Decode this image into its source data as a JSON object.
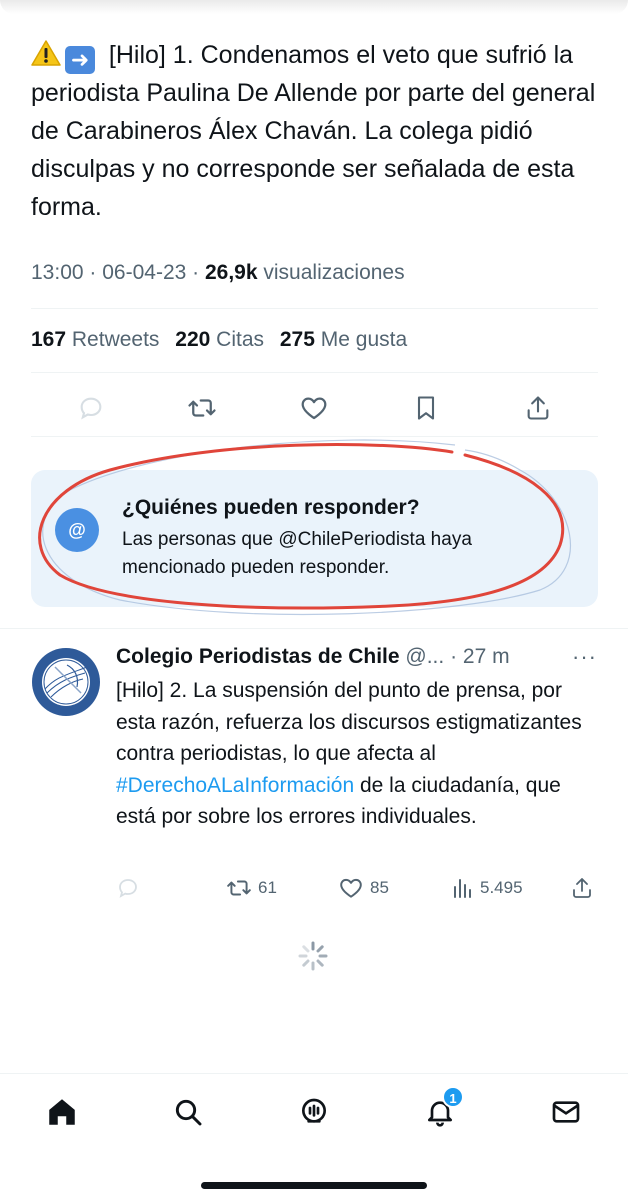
{
  "tweet": {
    "text": "[Hilo] 1. Condenamos el veto que sufrió la periodista Paulina De Allende por parte del general de Carabineros Álex Chaván. La colega pidió disculpas y no corresponde ser señalada de esta forma.",
    "time": "13:00",
    "date": "06-04-23",
    "views_count": "26,9k",
    "views_label": "visualizaciones",
    "retweets_count": "167",
    "retweets_label": "Retweets",
    "quotes_count": "220",
    "quotes_label": "Citas",
    "likes_count": "275",
    "likes_label": "Me gusta"
  },
  "reply_restriction": {
    "title": "¿Quiénes pueden responder?",
    "description": "Las personas que @ChilePeriodista haya mencionado pueden responder.",
    "icon_symbol": "@"
  },
  "reply_tweet": {
    "author_name": "Colegio Periodistas de Chile",
    "handle": "@...",
    "time": "27 m",
    "more": "···",
    "text_part1": "[Hilo] 2. La suspensión del punto de prensa, por esta razón, refuerza los discursos estigmatizantes contra periodistas, lo que afecta al ",
    "hashtag": "#DerechoALaInformación",
    "text_part2": " de la ciudadanía, que está por sobre los errores individuales.",
    "retweets": "61",
    "likes": "85",
    "views": "5.495",
    "avatar_text_top": "COLEGIO DE PERIODISTAS",
    "avatar_text_bottom": "DE CHILE"
  },
  "nav": {
    "notifications_badge": "1"
  },
  "colors": {
    "accent": "#1d9bf0",
    "muted": "#536471",
    "restriction_bg": "#eaf3fb",
    "annotation_red": "#e0453a"
  }
}
